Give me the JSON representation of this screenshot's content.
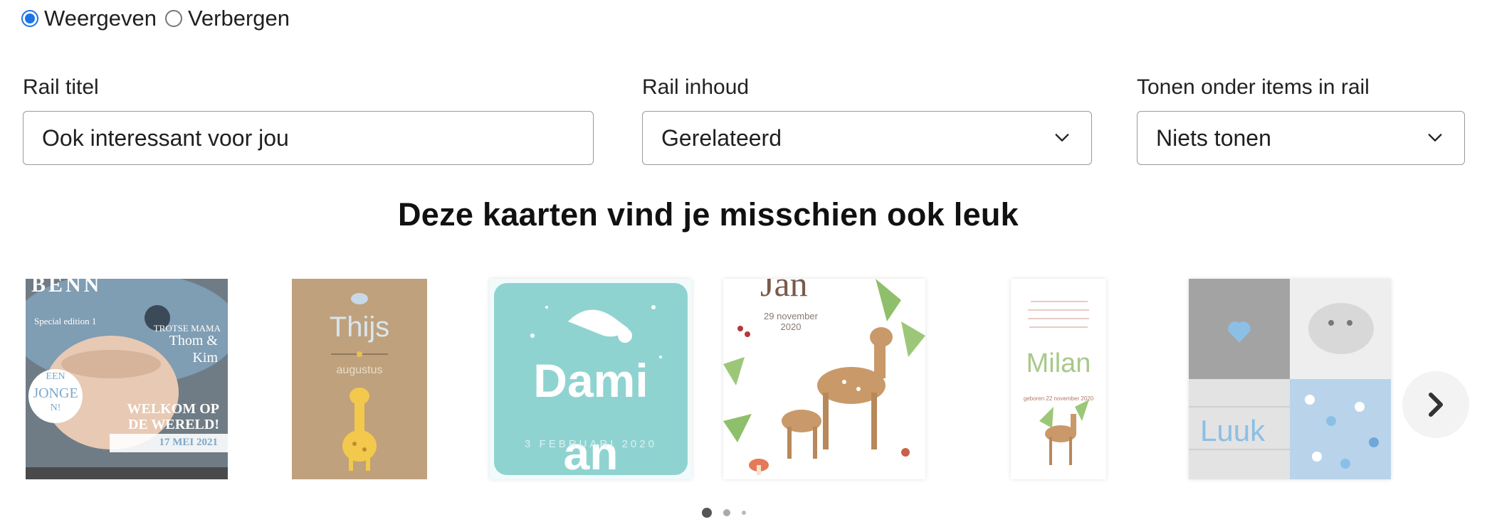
{
  "visibility": {
    "options": [
      "Weergeven",
      "Verbergen"
    ],
    "selected": "Weergeven"
  },
  "rail_title": {
    "label": "Rail titel",
    "value": "Ook interessant voor jou"
  },
  "rail_content": {
    "label": "Rail inhoud",
    "value": "Gerelateerd"
  },
  "show_under_items": {
    "label": "Tonen onder items in rail",
    "value": "Niets tonen"
  },
  "preview": {
    "heading": "Deze kaarten vind je misschien ook leuk",
    "cards": [
      {
        "name": "magazine",
        "texts": [
          "BENN",
          "Special edition 1",
          "TROTSE MAMA",
          "Thom &",
          "Kim",
          "EEN",
          "JONGE",
          "N!",
          "WELKOM OP",
          "DE WERELD!",
          "17 MEI 2021"
        ]
      },
      {
        "name": "giraffe",
        "texts": [
          "Thijs",
          "augustus"
        ]
      },
      {
        "name": "stork",
        "texts": [
          "Dami",
          "an",
          "3 FEBRUARI 2020"
        ]
      },
      {
        "name": "deer",
        "texts": [
          "Jan",
          "29 november",
          "2020"
        ]
      },
      {
        "name": "milan",
        "texts": [
          "Milan",
          "geboren 22 november 2020"
        ]
      },
      {
        "name": "luuk",
        "texts": [
          "Luuk"
        ]
      }
    ],
    "pagination": {
      "count": 3,
      "active": 1
    }
  },
  "colors": {
    "radio_accent": "#1a73e8",
    "heading": "#111111",
    "aqua": "#8fd3d1",
    "kraft": "#bfa17d",
    "gray_tile": "#a3a3a3",
    "blue_accent": "#8bbfe6"
  },
  "icons": {
    "select_arrow": "chevron-down-icon",
    "next": "chevron-right-icon"
  }
}
